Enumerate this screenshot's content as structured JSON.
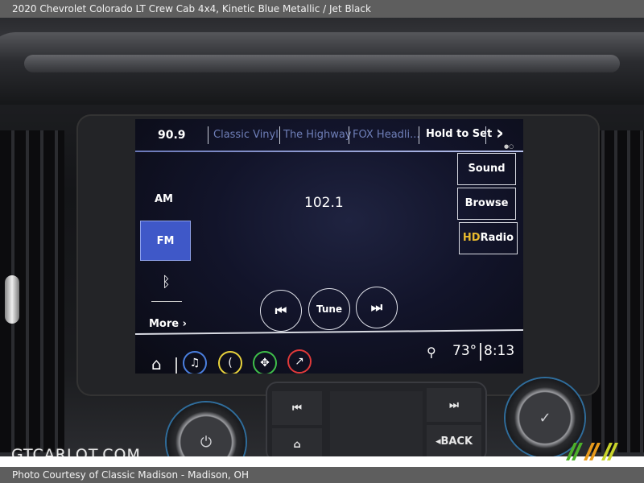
{
  "header": {
    "title": "2020 Chevrolet Colorado LT Crew Cab 4x4,  Kinetic Blue Metallic / Jet Black"
  },
  "footer": {
    "credit": "Photo Courtesy of Classic Madison - Madison, OH"
  },
  "watermark": {
    "text": "GTCARLOT.COM"
  },
  "radio": {
    "current_preset_freq": "90.9",
    "presets": [
      "Classic Vinyl",
      "The Highway",
      "FOX Headli..."
    ],
    "hold_to_set": "Hold to Set",
    "next_label": "›",
    "station": "102.1",
    "sources": [
      {
        "label": "AM",
        "selected": false
      },
      {
        "label": "FM",
        "selected": true
      },
      {
        "label": "bluetooth-icon",
        "selected": false
      }
    ],
    "more_label": "More ›",
    "side_buttons": [
      "Sound",
      "Browse"
    ],
    "hd_radio": {
      "hd": "HD",
      "radio": "Radio"
    },
    "transport": {
      "prev": "⏮",
      "tune": "Tune",
      "next": "⏭"
    },
    "status": {
      "temperature": "73°",
      "time": "8:13"
    },
    "app_tray": [
      {
        "name": "audio",
        "color": "#4a7fe0"
      },
      {
        "name": "phone",
        "color": "#e8d23c"
      },
      {
        "name": "navigation",
        "color": "#3fbf4a"
      },
      {
        "name": "apps",
        "color": "#e03a3a"
      }
    ]
  },
  "hardware": {
    "prev_track": "⏮",
    "next_track": "⏭",
    "back_label": "◂BACK",
    "power": "⏻",
    "confirm": "✓"
  }
}
